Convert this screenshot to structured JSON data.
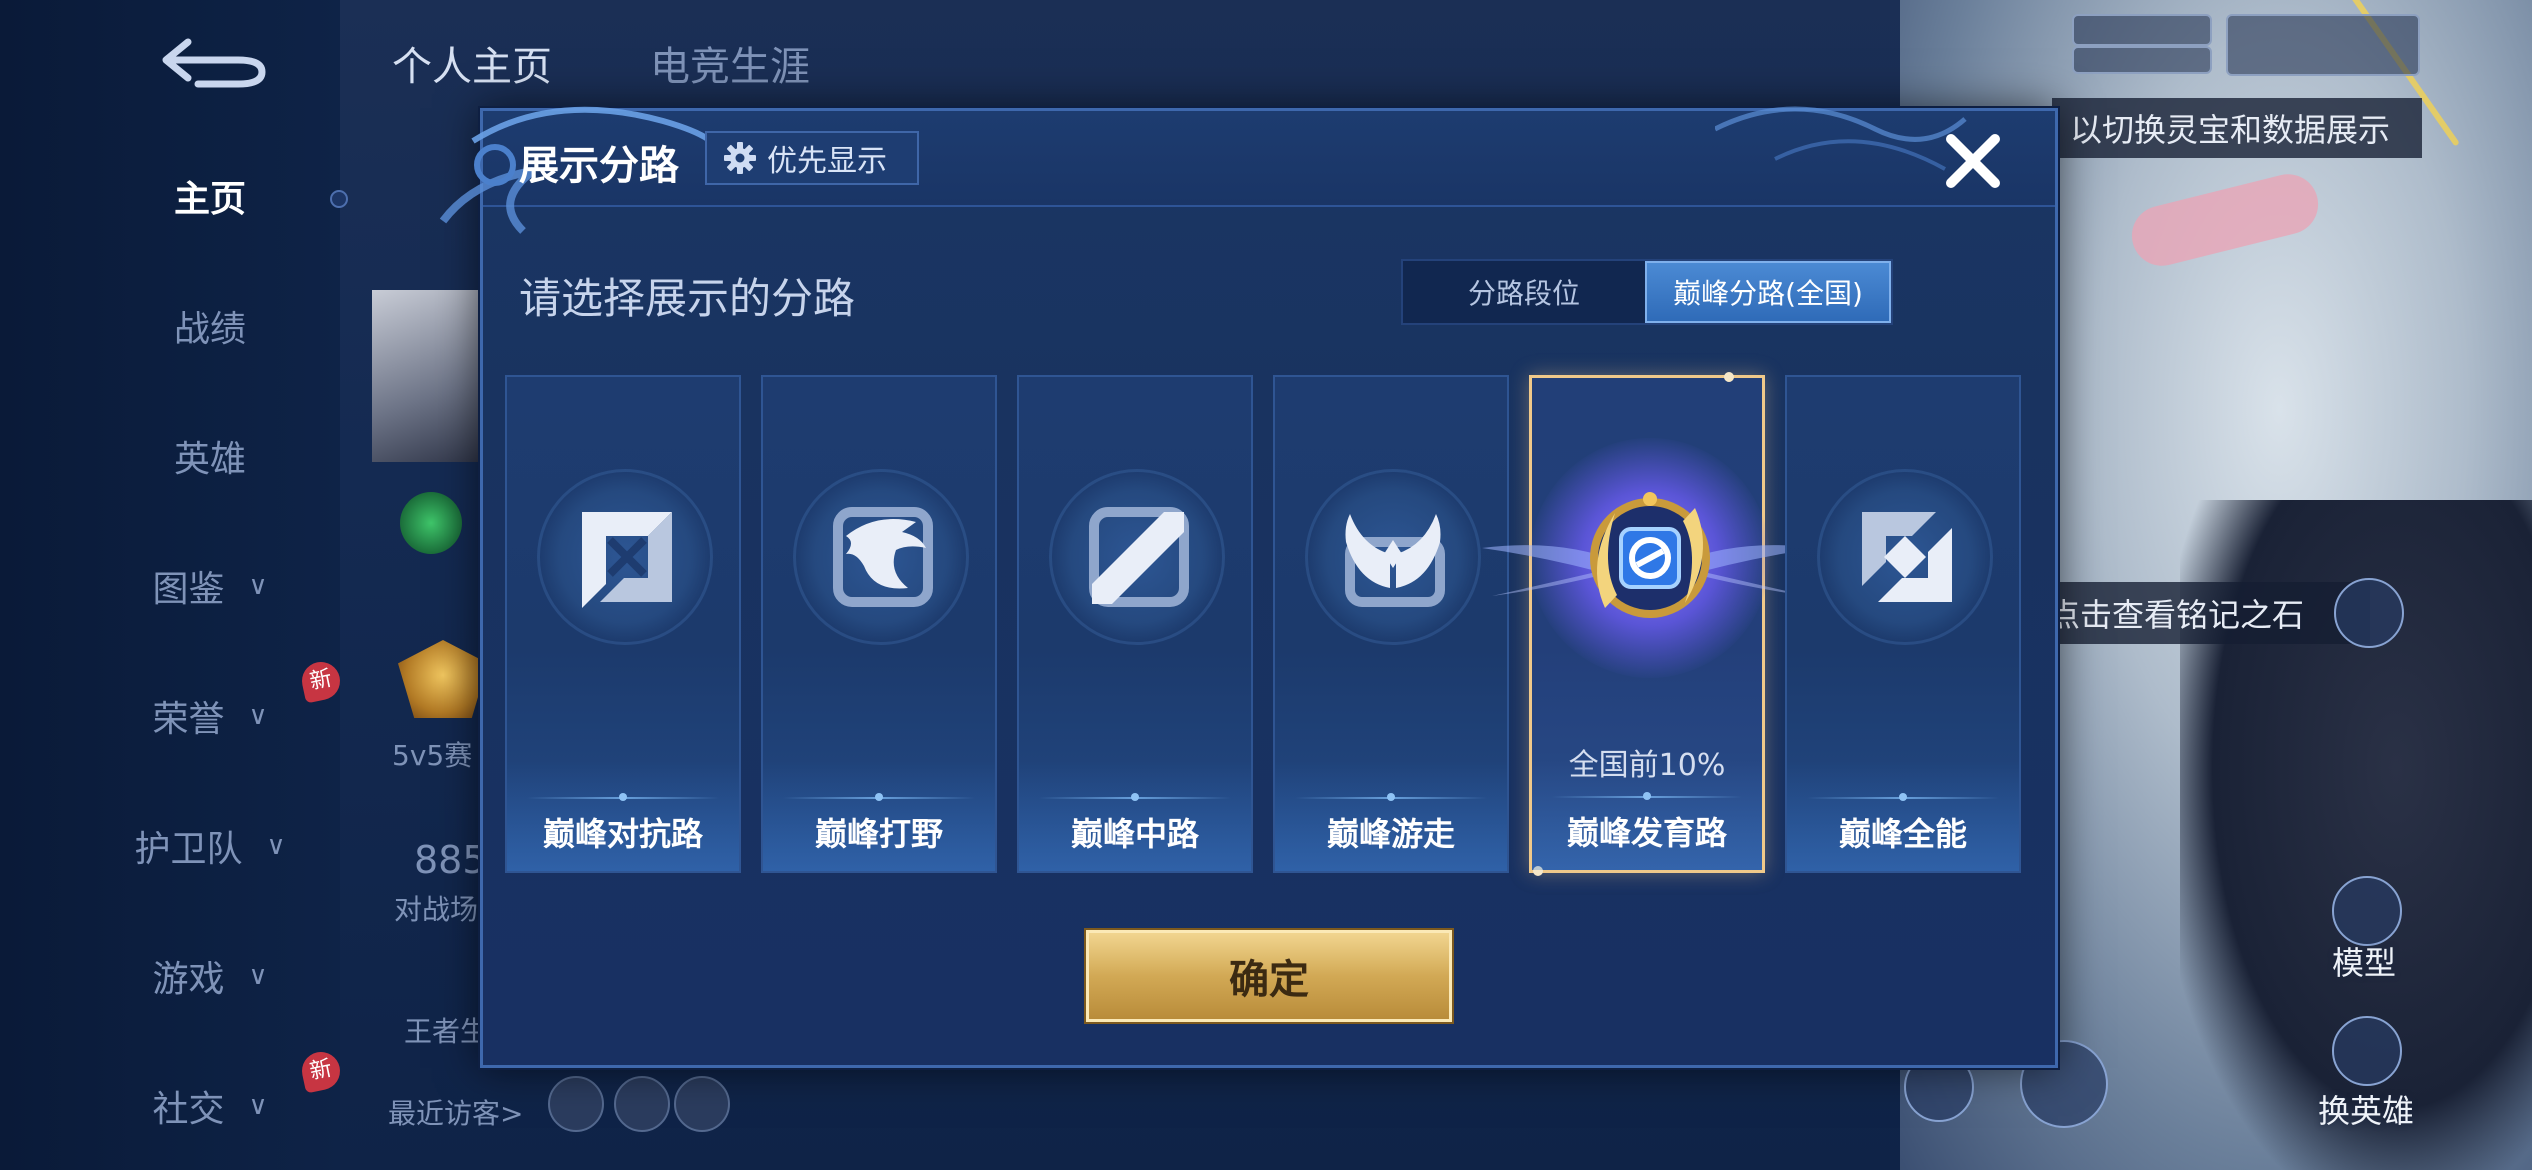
{
  "background": {
    "top_tabs": [
      "个人主页",
      "电竞生涯"
    ],
    "sidebar": [
      {
        "label": "主页",
        "active": true,
        "chevron": false,
        "new_badge": false
      },
      {
        "label": "战绩",
        "active": false,
        "chevron": false,
        "new_badge": false
      },
      {
        "label": "英雄",
        "active": false,
        "chevron": false,
        "new_badge": false
      },
      {
        "label": "图鉴",
        "active": false,
        "chevron": true,
        "new_badge": false
      },
      {
        "label": "荣誉",
        "active": false,
        "chevron": true,
        "new_badge": true
      },
      {
        "label": "护卫队",
        "active": false,
        "chevron": true,
        "new_badge": false
      },
      {
        "label": "游戏",
        "active": false,
        "chevron": true,
        "new_badge": false
      },
      {
        "label": "社交",
        "active": false,
        "chevron": true,
        "new_badge": true
      }
    ],
    "new_badge_text": "新",
    "partial_texts": {
      "mode_label": "5v5赛",
      "score": "885",
      "arena_label": "对战场",
      "king_label": "王者生",
      "recent_visitors": "最近访客>"
    },
    "right_panel": {
      "hint_top": "以切换灵宝和数据展示",
      "hint_mid": "点击查看铭记之石",
      "model_label": "模型",
      "switch_hero_label": "换英雄"
    }
  },
  "modal": {
    "title": "展示分路",
    "priority_button": "优先显示",
    "prompt": "请选择展示的分路",
    "segment_tabs": [
      {
        "label": "分路段位",
        "active": false
      },
      {
        "label": "巅峰分路(全国)",
        "active": true
      }
    ],
    "cards": [
      {
        "label": "巅峰对抗路",
        "icon": "clash-lane-icon",
        "selected": false,
        "rank": ""
      },
      {
        "label": "巅峰打野",
        "icon": "jungle-dragon-icon",
        "selected": false,
        "rank": ""
      },
      {
        "label": "巅峰中路",
        "icon": "mid-lane-icon",
        "selected": false,
        "rank": ""
      },
      {
        "label": "巅峰游走",
        "icon": "roam-wings-icon",
        "selected": false,
        "rank": ""
      },
      {
        "label": "巅峰发育路",
        "icon": "farm-lane-medal-icon",
        "selected": true,
        "rank": "全国前10%"
      },
      {
        "label": "巅峰全能",
        "icon": "all-round-icon",
        "selected": false,
        "rank": ""
      }
    ],
    "confirm_button": "确定"
  },
  "colors": {
    "modal_bg": "#193360",
    "accent_blue": "#3f7ccc",
    "selected_border": "#f0c98a",
    "confirm_gold": "#d2a955"
  }
}
